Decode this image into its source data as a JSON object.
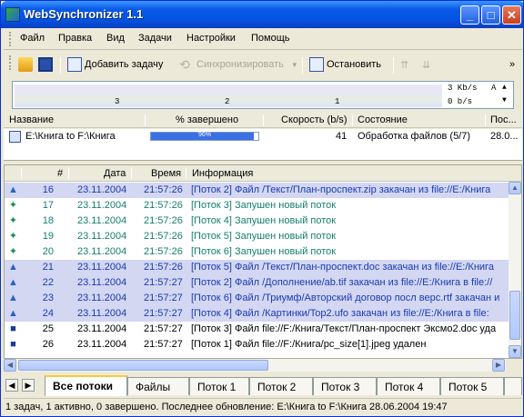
{
  "window": {
    "title": "WebSynchronizer 1.1",
    "minimize": "_",
    "maximize": "□",
    "close": "✕"
  },
  "menu": [
    "Файл",
    "Правка",
    "Вид",
    "Задачи",
    "Настройки",
    "Помощь"
  ],
  "toolbar": {
    "add_task": "Добавить задачу",
    "sync": "Синхронизировать",
    "stop": "Остановить"
  },
  "graph": {
    "labels": [
      "3",
      "2",
      "1"
    ],
    "speed_top": "3 Kb/s",
    "speed_bottom": "0 b/s",
    "marker_a": "A"
  },
  "tasks": {
    "columns": [
      "Название",
      "% завершено",
      "Скорость (b/s)",
      "Состояние",
      "Пос..."
    ],
    "rows": [
      {
        "name": "E:\\Книга to F:\\Книга",
        "percent": "96%",
        "percent_value": 96,
        "speed": "41",
        "state": "Обработка файлов (5/7)",
        "last": "28.0..."
      }
    ]
  },
  "log": {
    "columns": [
      "#",
      "Дата",
      "Время",
      "Информация"
    ],
    "rows": [
      {
        "icon": "upload-icon",
        "num": "16",
        "date": "23.11.2004",
        "time": "21:57:26",
        "info": "[Поток 2] Файл /Текст/План-проспект.zip закачан из file://E:/Книга",
        "style": "sel blue"
      },
      {
        "icon": "thread-icon",
        "num": "17",
        "date": "23.11.2004",
        "time": "21:57:26",
        "info": "[Поток 3] Запушен новый поток",
        "style": "green"
      },
      {
        "icon": "thread-icon",
        "num": "18",
        "date": "23.11.2004",
        "time": "21:57:26",
        "info": "[Поток 4] Запушен новый поток",
        "style": "green"
      },
      {
        "icon": "thread-icon",
        "num": "19",
        "date": "23.11.2004",
        "time": "21:57:26",
        "info": "[Поток 5] Запушен новый поток",
        "style": "green"
      },
      {
        "icon": "thread-icon",
        "num": "20",
        "date": "23.11.2004",
        "time": "21:57:26",
        "info": "[Поток 6] Запушен новый поток",
        "style": "green"
      },
      {
        "icon": "upload-icon",
        "num": "21",
        "date": "23.11.2004",
        "time": "21:57:26",
        "info": "[Поток 5] Файл /Текст/План-проспект.doc закачан из file://E:/Книга",
        "style": "sel blue"
      },
      {
        "icon": "upload-icon",
        "num": "22",
        "date": "23.11.2004",
        "time": "21:57:27",
        "info": "[Поток 2] Файл /Дополнение/ab.tif закачан из file://E:/Книга в file://",
        "style": "sel blue"
      },
      {
        "icon": "upload-icon",
        "num": "23",
        "date": "23.11.2004",
        "time": "21:57:27",
        "info": "[Поток 6] Файл /Триумф/Авторский договор посл верс.rtf закачан и",
        "style": "sel blue"
      },
      {
        "icon": "upload-icon",
        "num": "24",
        "date": "23.11.2004",
        "time": "21:57:27",
        "info": "[Поток 4] Файл /Картинки/Top2.ufo закачан из file://E:/Книга в file:",
        "style": "sel blue"
      },
      {
        "icon": "delete-icon",
        "num": "25",
        "date": "23.11.2004",
        "time": "21:57:27",
        "info": "[Поток 3] Файл file://F:/Книга/Текст/План-проспект Эксмо2.doc уда",
        "style": ""
      },
      {
        "icon": "delete-icon",
        "num": "26",
        "date": "23.11.2004",
        "time": "21:57:27",
        "info": "[Поток 1] Файл file://F:/Книга/pc_size[1].jpeg удален",
        "style": ""
      }
    ]
  },
  "tabs": [
    "Все потоки",
    "Файлы",
    "Поток 1",
    "Поток 2",
    "Поток 3",
    "Поток 4",
    "Поток 5"
  ],
  "status": "1 задач, 1 активно, 0 завершено. Последнее обновление: E:\\Книга to F:\\Книга 28.06.2004 19:47"
}
